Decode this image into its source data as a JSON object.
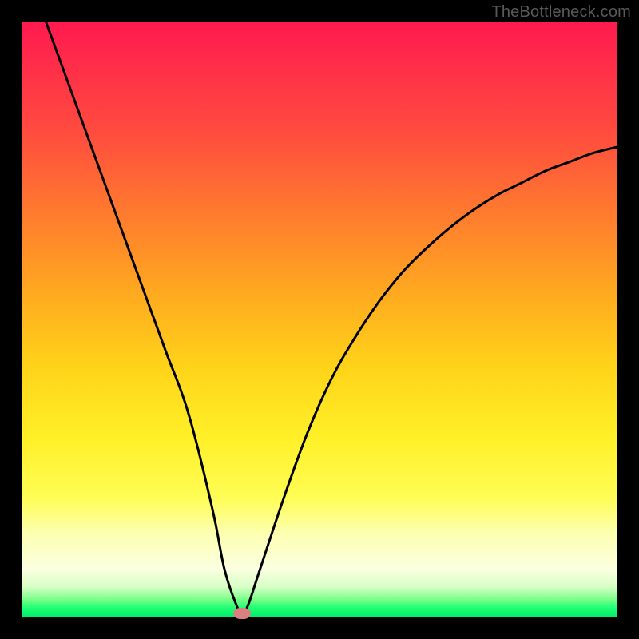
{
  "watermark": "TheBottleneck.com",
  "chart_data": {
    "type": "line",
    "title": "",
    "xlabel": "",
    "ylabel": "",
    "xlim": [
      0,
      100
    ],
    "ylim": [
      0,
      100
    ],
    "series": [
      {
        "name": "curve",
        "x": [
          4,
          8,
          12,
          16,
          20,
          24,
          28,
          32,
          34,
          36,
          37,
          38,
          40,
          44,
          48,
          52,
          56,
          60,
          64,
          68,
          72,
          76,
          80,
          84,
          88,
          92,
          96,
          100
        ],
        "values": [
          100,
          89,
          78,
          67,
          56,
          45,
          34,
          18,
          8,
          2,
          0.5,
          2,
          8,
          20,
          31,
          40,
          47,
          53,
          58,
          62,
          65.5,
          68.5,
          71,
          73,
          75,
          76.5,
          78,
          79
        ]
      }
    ],
    "marker": {
      "x": 37,
      "y": 0.5,
      "color": "#d98080"
    },
    "background_gradient": {
      "top": "#ff1a4f",
      "mid": "#fff028",
      "bottom": "#00ef6a"
    }
  }
}
